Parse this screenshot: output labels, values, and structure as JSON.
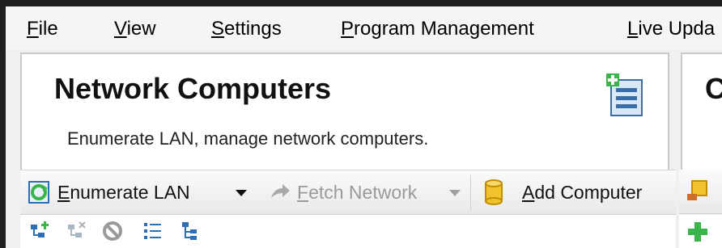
{
  "menu": {
    "file": "File",
    "view": "View",
    "settings": "Settings",
    "program_management": "Program Management",
    "live_update": "Live Upda"
  },
  "panel": {
    "title": "Network Computers",
    "description": "Enumerate LAN, manage network computers."
  },
  "panel2": {
    "title": "C"
  },
  "toolbar": {
    "enumerate_lan": "Enumerate LAN",
    "fetch_network": "Fetch Network",
    "add_computer": "Add Computer"
  },
  "icons": {
    "panel_icon": "network-list-add-icon",
    "enumerate": "refresh-icon",
    "fetch": "forward-arrow-icon",
    "add_computer": "database-icon",
    "row": [
      "tree-add-icon",
      "tree-remove-icon",
      "block-icon",
      "list-icon",
      "tree-icon"
    ]
  },
  "colors": {
    "accent_green": "#3bb54a",
    "accent_yellow": "#f2c12e",
    "accent_blue": "#2d6fb7"
  }
}
